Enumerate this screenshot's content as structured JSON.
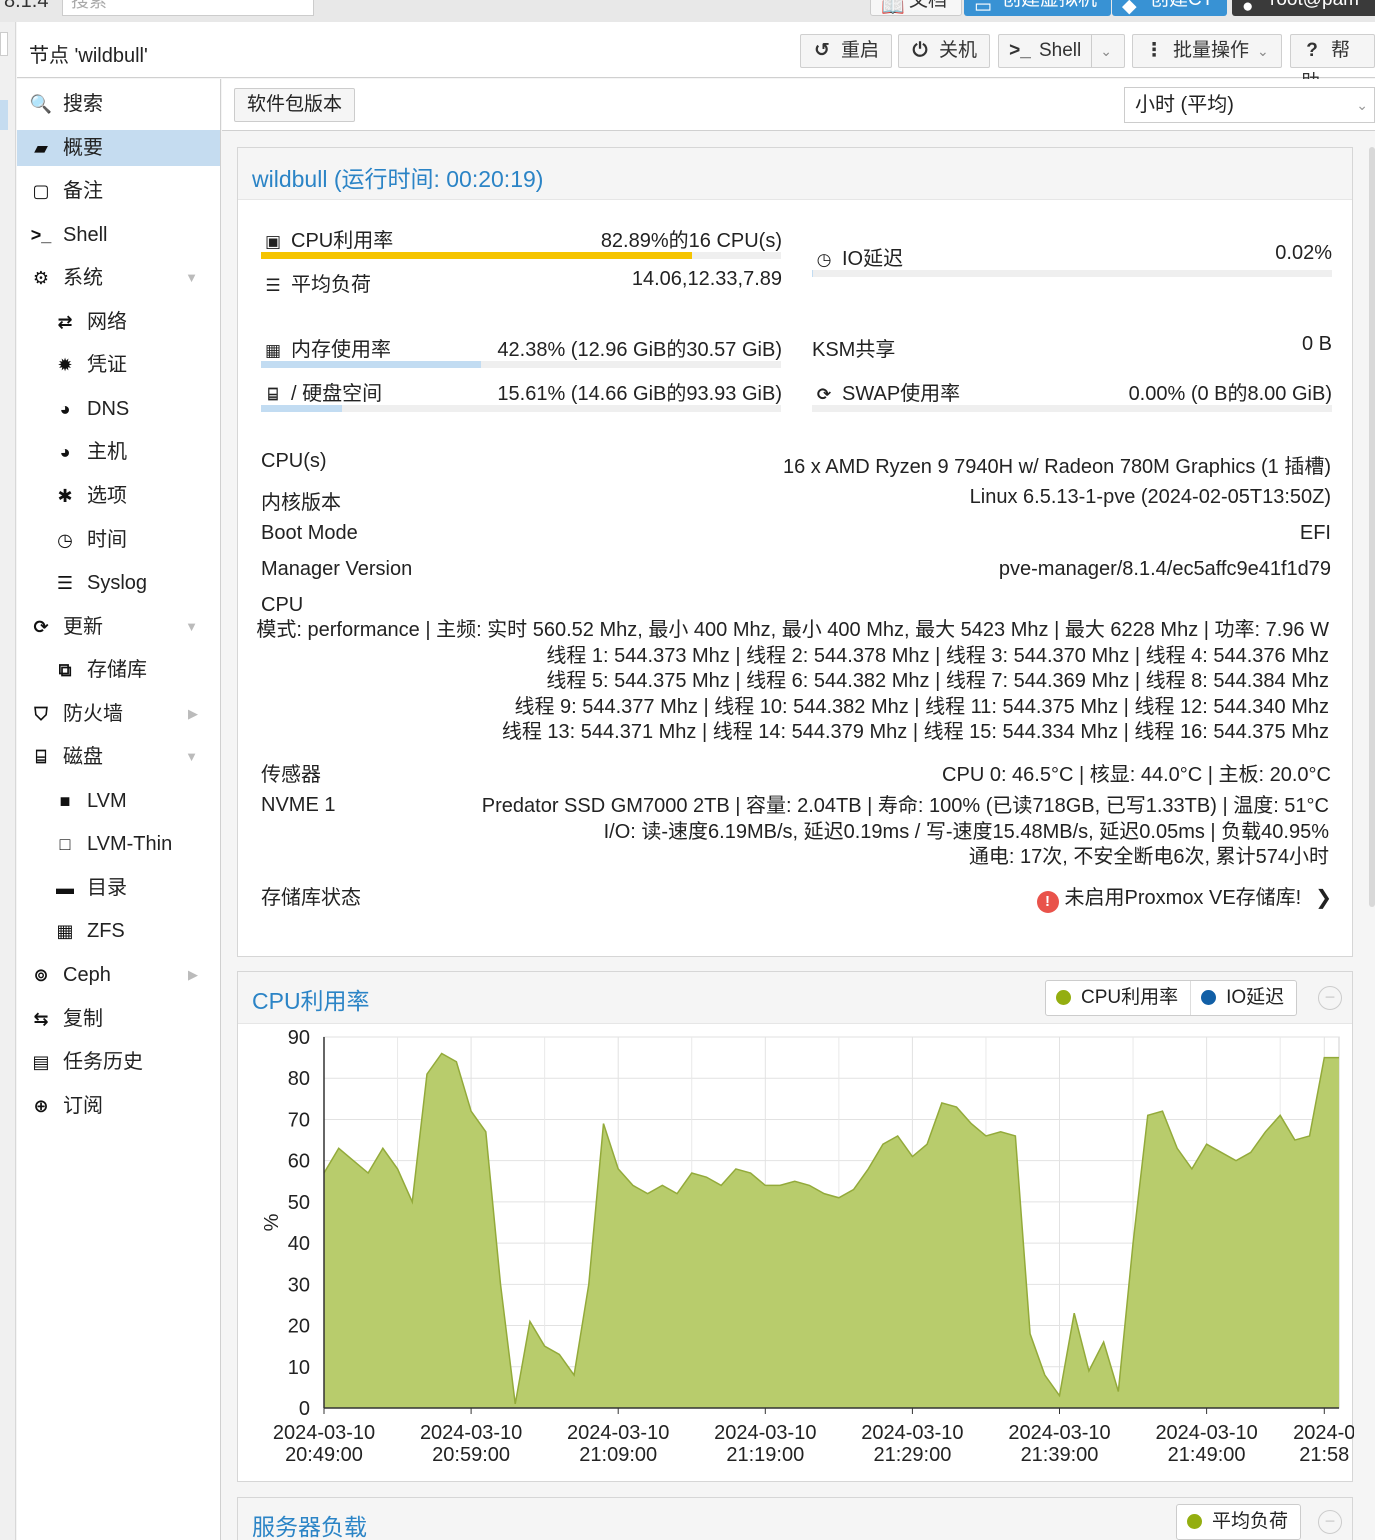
{
  "topbar": {
    "version": "8.1.4",
    "search_placeholder": "搜索",
    "docs_label": "文档",
    "create_vm_label": "创建虚拟机",
    "create_ct_label": "创建CT",
    "user_label": "root@pam"
  },
  "node_header": {
    "title": "节点 'wildbull'",
    "reboot_label": "重启",
    "shutdown_label": "关机",
    "shell_label": "Shell",
    "bulk_label": "批量操作",
    "help_label": "帮助"
  },
  "sidebar": {
    "items": [
      {
        "label": "搜索",
        "icon": "search-icon"
      },
      {
        "label": "概要",
        "icon": "book-icon",
        "selected": true
      },
      {
        "label": "备注",
        "icon": "note-icon"
      },
      {
        "label": "Shell",
        "icon": "terminal-icon"
      },
      {
        "label": "系统",
        "icon": "cogs-icon",
        "expandable": "down"
      },
      {
        "label": "网络",
        "icon": "exchange-icon",
        "indent": true
      },
      {
        "label": "凭证",
        "icon": "certificate-icon",
        "indent": true
      },
      {
        "label": "DNS",
        "icon": "globe-icon",
        "indent": true
      },
      {
        "label": "主机",
        "icon": "globe-icon",
        "indent": true
      },
      {
        "label": "选项",
        "icon": "gear-icon",
        "indent": true
      },
      {
        "label": "时间",
        "icon": "clock-icon",
        "indent": true
      },
      {
        "label": "Syslog",
        "icon": "list-icon",
        "indent": true
      },
      {
        "label": "更新",
        "icon": "refresh-icon",
        "expandable": "down"
      },
      {
        "label": "存储库",
        "icon": "files-icon",
        "indent": true
      },
      {
        "label": "防火墙",
        "icon": "shield-icon",
        "expandable": "right"
      },
      {
        "label": "磁盘",
        "icon": "hdd-icon",
        "expandable": "down"
      },
      {
        "label": "LVM",
        "icon": "square-icon",
        "indent": true
      },
      {
        "label": "LVM-Thin",
        "icon": "square-outline-icon",
        "indent": true
      },
      {
        "label": "目录",
        "icon": "folder-icon",
        "indent": true
      },
      {
        "label": "ZFS",
        "icon": "th-large-icon",
        "indent": true
      },
      {
        "label": "Ceph",
        "icon": "ceph-icon",
        "expandable": "right"
      },
      {
        "label": "复制",
        "icon": "retweet-icon"
      },
      {
        "label": "任务历史",
        "icon": "list-alt-icon"
      },
      {
        "label": "订阅",
        "icon": "support-icon"
      }
    ]
  },
  "toolbar": {
    "package_versions_label": "软件包版本",
    "timeframe": "小时 (平均)"
  },
  "status": {
    "title": "wildbull (运行时间: 00:20:19)",
    "cpu_label": "CPU利用率",
    "cpu_value": "82.89%的16 CPU(s)",
    "cpu_fraction": 0.8289,
    "io_label": "IO延迟",
    "io_value": "0.02%",
    "io_fraction": 0.0002,
    "load_label": "平均负荷",
    "load_value": "14.06,12.33,7.89",
    "mem_label": "内存使用率",
    "mem_value": "42.38% (12.96 GiB的30.57 GiB)",
    "mem_fraction": 0.4238,
    "ksm_label": "KSM共享",
    "ksm_value": "0 B",
    "disk_label": "/ 硬盘空间",
    "disk_value": "15.61% (14.66 GiB的93.93 GiB)",
    "disk_fraction": 0.1561,
    "swap_label": "SWAP使用率",
    "swap_value": "0.00% (0 B的8.00 GiB)",
    "swap_fraction": 0,
    "cpus_label": "CPU(s)",
    "cpus_value": "16 x AMD Ryzen 9 7940H w/ Radeon 780M Graphics (1 插槽)",
    "kernel_label": "内核版本",
    "kernel_value": "Linux 6.5.13-1-pve (2024-02-05T13:50Z)",
    "boot_label": "Boot Mode",
    "boot_value": "EFI",
    "manager_label": "Manager Version",
    "manager_value": "pve-manager/8.1.4/ec5affc9e41f1d79",
    "cpu_detail_label": "CPU",
    "cpu_detail_lines": [
      "模式: performance | 主频: 实时 560.52 Mhz, 最小 400 Mhz, 最小 400 Mhz, 最大 5423 Mhz | 最大 6228 Mhz | 功率: 7.96 W",
      "线程 1: 544.373 Mhz | 线程 2: 544.378 Mhz | 线程 3: 544.370 Mhz | 线程 4: 544.376 Mhz",
      "线程 5: 544.375 Mhz | 线程 6: 544.382 Mhz | 线程 7: 544.369 Mhz | 线程 8: 544.384 Mhz",
      "线程 9: 544.377 Mhz | 线程 10: 544.382 Mhz | 线程 11: 544.375 Mhz | 线程 12: 544.340 Mhz",
      "线程 13: 544.371 Mhz | 线程 14: 544.379 Mhz | 线程 15: 544.334 Mhz | 线程 16: 544.375 Mhz"
    ],
    "sensors_label": "传感器",
    "sensors_value": "CPU 0: 46.5°C | 核显: 44.0°C | 主板: 20.0°C",
    "nvme_label": "NVME 1",
    "nvme_lines": [
      "Predator SSD GM7000 2TB | 容量: 2.04TB | 寿命: 100% (已读718GB, 已写1.33TB) | 温度: 51°C",
      "I/O: 读-速度6.19MB/s, 延迟0.19ms / 写-速度15.48MB/s, 延迟0.05ms | 负载40.95%",
      "通电: 17次, 不安全断电6次, 累计574小时"
    ],
    "repo_label": "存储库状态",
    "repo_value": "未启用Proxmox VE存储库!"
  },
  "cpu_panel": {
    "title": "CPU利用率",
    "legend_cpu": "CPU利用率",
    "legend_io": "IO延迟"
  },
  "load_panel": {
    "title": "服务器负载",
    "legend_load": "平均负荷"
  },
  "colors": {
    "accent": "#2b84c6",
    "cpu_bar": "#f5c400",
    "mem_bar": "#c2dcf2",
    "chart_fill": "#b8cc6c",
    "chart_line": "#93aa3a",
    "legend_cpu": "#94ae10",
    "legend_io": "#115fa6"
  },
  "chart_data": {
    "type": "area",
    "title": "CPU利用率",
    "ylabel": "%",
    "ylim": [
      0,
      90
    ],
    "yticks": [
      0,
      10,
      20,
      30,
      40,
      50,
      60,
      70,
      80,
      90
    ],
    "xlim": [
      0,
      69
    ],
    "x_tick_positions": [
      0,
      10,
      20,
      30,
      40,
      50,
      60,
      68
    ],
    "x_tick_labels": [
      [
        "2024-03-10",
        "20:49:00"
      ],
      [
        "2024-03-10",
        "20:59:00"
      ],
      [
        "2024-03-10",
        "21:09:00"
      ],
      [
        "2024-03-10",
        "21:19:00"
      ],
      [
        "2024-03-10",
        "21:29:00"
      ],
      [
        "2024-03-10",
        "21:39:00"
      ],
      [
        "2024-03-10",
        "21:49:00"
      ],
      [
        "2024-0",
        "21:58"
      ]
    ],
    "grid": true,
    "series": [
      {
        "name": "CPU利用率",
        "x": [
          0,
          1,
          2,
          3,
          4,
          5,
          6,
          7,
          8,
          9,
          10,
          11,
          12,
          13,
          14,
          15,
          16,
          17,
          18,
          19,
          20,
          21,
          22,
          23,
          24,
          25,
          26,
          27,
          28,
          29,
          30,
          31,
          32,
          33,
          34,
          35,
          36,
          37,
          38,
          39,
          40,
          41,
          42,
          43,
          44,
          45,
          46,
          47,
          48,
          49,
          50,
          51,
          52,
          53,
          54,
          55,
          56,
          57,
          58,
          59,
          60,
          61,
          62,
          63,
          64,
          65,
          66,
          67,
          68,
          69
        ],
        "values": [
          57,
          63,
          60,
          57,
          63,
          58,
          50,
          81,
          86,
          84,
          72,
          67,
          30,
          1,
          21,
          15,
          13,
          8,
          30,
          69,
          58,
          54,
          52,
          54,
          52,
          57,
          56,
          54,
          58,
          57,
          54,
          54,
          55,
          54,
          52,
          51,
          53,
          58,
          64,
          66,
          61,
          64,
          74,
          73,
          69,
          66,
          67,
          66,
          18,
          8,
          3,
          23,
          9,
          16,
          4,
          40,
          71,
          72,
          63,
          58,
          64,
          62,
          60,
          62,
          67,
          71,
          65,
          66,
          85,
          85
        ]
      }
    ]
  }
}
